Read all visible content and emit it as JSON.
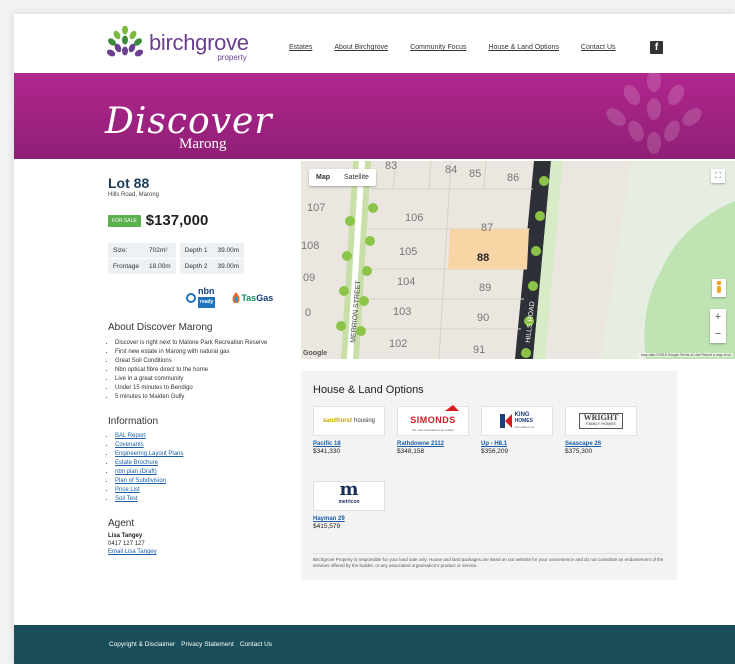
{
  "brand": {
    "name": "birchgrove",
    "sub": "property"
  },
  "nav": [
    "Estates",
    "About Birchgrove",
    "Community Focus",
    "House & Land Options",
    "Contact Us"
  ],
  "social": {
    "label": "f"
  },
  "banner": {
    "title": "Discover",
    "subtitle": "Marong"
  },
  "lot": {
    "title": "Lot 88",
    "address": "Hills Road, Marong",
    "badge": "FOR SALE",
    "price": "$137,000",
    "specs": [
      {
        "label": "Size:",
        "value": "702m²"
      },
      {
        "label": "Frontage",
        "value": "18.00m"
      },
      {
        "label": "Depth 1",
        "value": "39.00m"
      },
      {
        "label": "Depth 2",
        "value": "39.00m"
      }
    ]
  },
  "partners": {
    "nbn": "nbn",
    "nbn_ready": "ready",
    "tasgas_a": "Tas",
    "tasgas_b": "Gas"
  },
  "about": {
    "heading": "About Discover Marong",
    "items": [
      "Discover is right next to Malone Park Recreation Reserve",
      "First new estate in Marong with natural gas",
      "Great Soil Conditions",
      "Nbn optical fibre direct to the home",
      "Live in a great community",
      "Under 15 minutes to Bendigo",
      "5 minutes to Maiden Gully"
    ]
  },
  "information": {
    "heading": "Information",
    "links": [
      "BAL Report",
      "Covenants",
      "Engineering Layout Plans",
      "Estate Brochure",
      "nbn plan (Draft)",
      "Plan of Subdivision",
      "Price List",
      "Soil Test"
    ]
  },
  "agent": {
    "heading": "Agent",
    "name": "Lisa Tangey",
    "phone": "0417 127 127",
    "email": "Email Lisa Tangey"
  },
  "map": {
    "tabs": [
      "Map",
      "Satellite"
    ],
    "selected": "Map",
    "lots": [
      "83",
      "84",
      "85",
      "86",
      "107",
      "106",
      "87",
      "108",
      "105",
      "88",
      "09",
      "104",
      "89",
      "0",
      "103",
      "90",
      "102",
      "91"
    ],
    "streets": [
      "MERRION STREET",
      "HILLS ROAD"
    ],
    "google": "Google",
    "credits": "Map data ©2018 Google   Terms of Use   Report a map error",
    "zoom_in": "+",
    "zoom_out": "−",
    "fullscreen": "⛶",
    "highlight_color": "#f9d5a6"
  },
  "house_land": {
    "heading": "House & Land Options",
    "options": [
      {
        "name": "Pacific 18",
        "price": "$341,330",
        "logo_a": "sandhurst",
        "logo_b": "housing"
      },
      {
        "name": "Rathdowne 2112",
        "price": "$348,158",
        "logo_a": "SIMONDS",
        "logo_b": "the most awarded home builder"
      },
      {
        "name": "Up - H8.1",
        "price": "$356,209",
        "logo_a": "KING",
        "logo_b": "HOMES",
        "logo_c": "Life starts here"
      },
      {
        "name": "Seascape 26",
        "price": "$375,300",
        "logo_a": "WRIGHT",
        "logo_b": "FAMILY HOMES"
      },
      {
        "name": "Hayman 29",
        "price": "$415,579",
        "logo_a": "m",
        "logo_b": "metricon"
      }
    ],
    "disclaimer": "Birchgrove Property is responsible for your land sale only. House and land packages are listed on our website for your convenience and do not constitute an endorsement of the services offered by the builder, or any associated organisation's product or service."
  },
  "footer": [
    "Copyright & Disclaimer",
    "Privacy Statement",
    "Contact Us"
  ],
  "colors": {
    "brand_purple": "#6b3f8f",
    "banner": "#b1268e",
    "footer": "#1a4e5a",
    "link": "#1a5fa9",
    "badge": "#5cb14f"
  }
}
